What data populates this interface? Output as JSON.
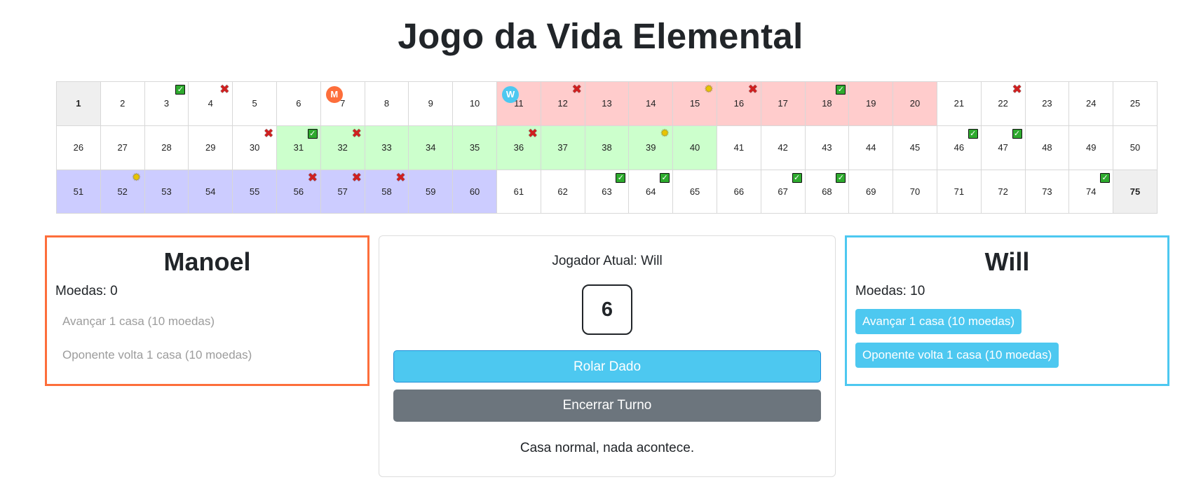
{
  "title": "Jogo da Vida Elemental",
  "board": {
    "cells": [
      {
        "n": "1",
        "color": "endpoint"
      },
      {
        "n": "2"
      },
      {
        "n": "3",
        "mark": "check"
      },
      {
        "n": "4",
        "mark": "cross"
      },
      {
        "n": "5"
      },
      {
        "n": "6"
      },
      {
        "n": "7",
        "token": "M"
      },
      {
        "n": "8"
      },
      {
        "n": "9"
      },
      {
        "n": "10"
      },
      {
        "n": "11",
        "color": "red",
        "token": "W"
      },
      {
        "n": "12",
        "color": "red",
        "mark": "cross"
      },
      {
        "n": "13",
        "color": "red"
      },
      {
        "n": "14",
        "color": "red"
      },
      {
        "n": "15",
        "color": "red",
        "mark": "burst"
      },
      {
        "n": "16",
        "color": "red",
        "mark": "cross"
      },
      {
        "n": "17",
        "color": "red"
      },
      {
        "n": "18",
        "color": "red",
        "mark": "check"
      },
      {
        "n": "19",
        "color": "red"
      },
      {
        "n": "20",
        "color": "red"
      },
      {
        "n": "21"
      },
      {
        "n": "22",
        "mark": "cross"
      },
      {
        "n": "23"
      },
      {
        "n": "24"
      },
      {
        "n": "25"
      },
      {
        "n": "26"
      },
      {
        "n": "27"
      },
      {
        "n": "28"
      },
      {
        "n": "29"
      },
      {
        "n": "30",
        "mark": "cross"
      },
      {
        "n": "31",
        "color": "green",
        "mark": "check"
      },
      {
        "n": "32",
        "color": "green",
        "mark": "cross"
      },
      {
        "n": "33",
        "color": "green"
      },
      {
        "n": "34",
        "color": "green"
      },
      {
        "n": "35",
        "color": "green"
      },
      {
        "n": "36",
        "color": "green",
        "mark": "cross"
      },
      {
        "n": "37",
        "color": "green"
      },
      {
        "n": "38",
        "color": "green"
      },
      {
        "n": "39",
        "color": "green",
        "mark": "burst"
      },
      {
        "n": "40",
        "color": "green"
      },
      {
        "n": "41"
      },
      {
        "n": "42"
      },
      {
        "n": "43"
      },
      {
        "n": "44"
      },
      {
        "n": "45"
      },
      {
        "n": "46",
        "mark": "check"
      },
      {
        "n": "47",
        "mark": "check"
      },
      {
        "n": "48"
      },
      {
        "n": "49"
      },
      {
        "n": "50"
      },
      {
        "n": "51",
        "color": "blue"
      },
      {
        "n": "52",
        "color": "blue",
        "mark": "burst"
      },
      {
        "n": "53",
        "color": "blue"
      },
      {
        "n": "54",
        "color": "blue"
      },
      {
        "n": "55",
        "color": "blue"
      },
      {
        "n": "56",
        "color": "blue",
        "mark": "cross"
      },
      {
        "n": "57",
        "color": "blue",
        "mark": "cross"
      },
      {
        "n": "58",
        "color": "blue",
        "mark": "cross"
      },
      {
        "n": "59",
        "color": "blue"
      },
      {
        "n": "60",
        "color": "blue"
      },
      {
        "n": "61"
      },
      {
        "n": "62"
      },
      {
        "n": "63",
        "mark": "check"
      },
      {
        "n": "64",
        "mark": "check"
      },
      {
        "n": "65"
      },
      {
        "n": "66"
      },
      {
        "n": "67",
        "mark": "check"
      },
      {
        "n": "68",
        "mark": "check"
      },
      {
        "n": "69"
      },
      {
        "n": "70"
      },
      {
        "n": "71"
      },
      {
        "n": "72"
      },
      {
        "n": "73"
      },
      {
        "n": "74",
        "mark": "check"
      },
      {
        "n": "75",
        "color": "endpoint"
      }
    ]
  },
  "player1": {
    "name": "Manoel",
    "coins": "Moedas: 0",
    "advance_label": "Avançar 1 casa (10 moedas)",
    "push_back_label": "Oponente volta 1 casa (10 moedas)",
    "accent": "#fd6e3b"
  },
  "player2": {
    "name": "Will",
    "coins": "Moedas: 10",
    "advance_label": "Avançar 1 casa (10 moedas)",
    "push_back_label": "Oponente volta 1 casa (10 moedas)",
    "accent": "#4dc8f0"
  },
  "center": {
    "current_player": "Jogador Atual: Will",
    "dice_value": "6",
    "roll_label": "Rolar Dado",
    "end_turn_label": "Encerrar Turno",
    "message": "Casa normal, nada acontece."
  }
}
